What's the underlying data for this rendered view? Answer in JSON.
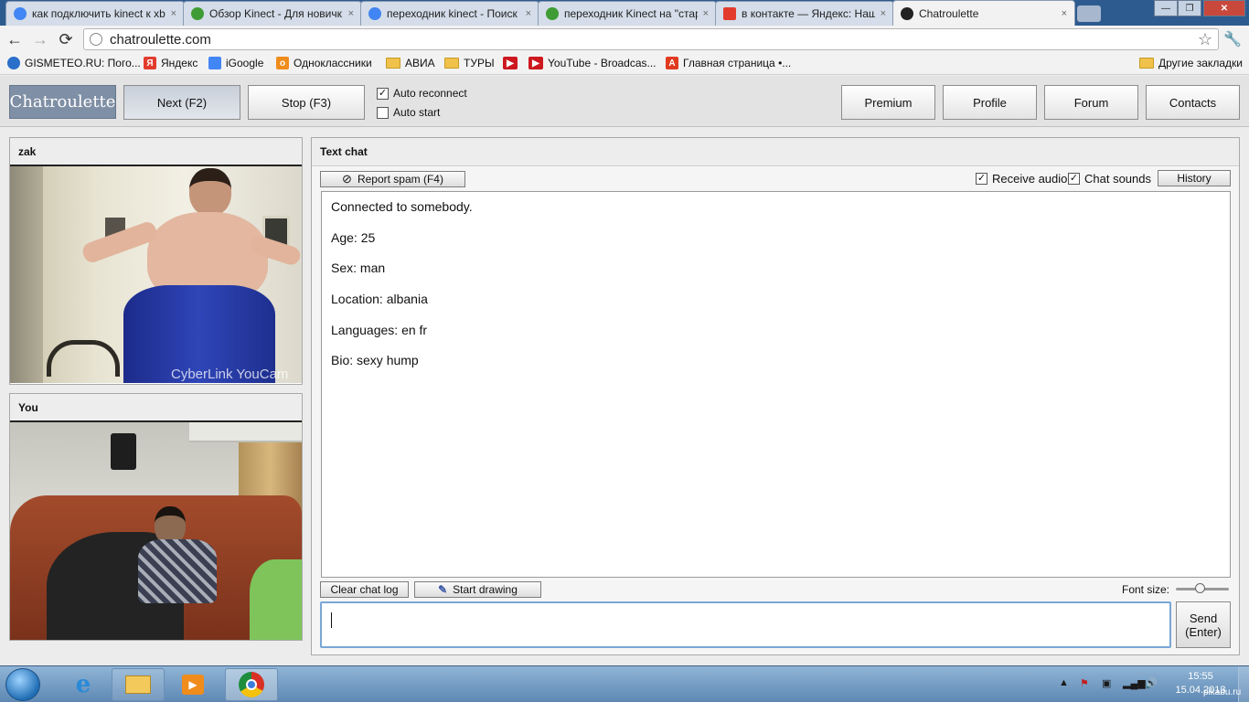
{
  "browser": {
    "tabs": [
      {
        "label": "как подключить kinect к xb",
        "color": "#4285f4"
      },
      {
        "label": "Обзор Kinect - Для новичк",
        "color": "#3f9c35"
      },
      {
        "label": "переходник kinect - Поиск",
        "color": "#4285f4"
      },
      {
        "label": "переходник Kinect на \"стар",
        "color": "#3f9c35"
      },
      {
        "label": "в контакте — Яндекс: Наш",
        "color": "#e23b2e"
      },
      {
        "label": "Chatroulette",
        "color": "#222222"
      }
    ],
    "tab_close": "×",
    "window_controls": {
      "minimize": "—",
      "maximize": "❐",
      "close": "✕"
    },
    "nav": {
      "back": "←",
      "forward": "→",
      "reload": "⟳"
    },
    "url": "chatroulette.com",
    "star_icon": "☆",
    "wrench_icon": "🔧",
    "bookmarks": [
      {
        "label": "GISMETEO.RU: Пого...",
        "icon": "gismeteo-icon",
        "color": "#2a6fc9"
      },
      {
        "label": "Яндекс",
        "icon": "yandex-icon",
        "color": "#e23b2e"
      },
      {
        "label": "iGoogle",
        "icon": "igoogle-icon",
        "color": "#4285f4"
      },
      {
        "label": "Одноклассники",
        "icon": "odnoklassniki-icon",
        "color": "#f08c1c"
      },
      {
        "label": "АВИА",
        "icon": "folder-icon",
        "color": "#f0c24c"
      },
      {
        "label": "ТУРЫ",
        "icon": "folder-icon",
        "color": "#f0c24c"
      },
      {
        "label": "",
        "icon": "youtube-icon",
        "color": "#cc181e"
      },
      {
        "label": "YouTube - Broadcas...",
        "icon": "youtube-icon",
        "color": "#cc181e"
      },
      {
        "label": "Главная страница •...",
        "icon": "adobe-icon",
        "color": "#e03a1f"
      }
    ],
    "other_bookmarks": "Другие закладки"
  },
  "app": {
    "logo": "Chatroulette",
    "next_label": "Next (F2)",
    "stop_label": "Stop (F3)",
    "auto_reconnect": {
      "label": "Auto reconnect",
      "checked": true
    },
    "auto_start": {
      "label": "Auto start",
      "checked": false
    },
    "nav": [
      "Premium",
      "Profile",
      "Forum",
      "Contacts"
    ]
  },
  "partner": {
    "name": "zak",
    "watermark": "CyberLink YouCam"
  },
  "self": {
    "name": "You"
  },
  "chat": {
    "title": "Text chat",
    "report_spam": "Report spam (F4)",
    "receive_audio": {
      "label": "Receive audio",
      "checked": true
    },
    "chat_sounds": {
      "label": "Chat sounds",
      "checked": true
    },
    "history": "History",
    "lines": [
      "Connected to somebody.",
      "Age: 25",
      "Sex: man",
      "Location: albania",
      "Languages: en fr",
      "Bio: sexy hump"
    ],
    "clear_log": "Clear chat log",
    "start_drawing": "Start drawing",
    "font_size_label": "Font size:",
    "font_size_level": 0.45,
    "send_line1": "Send",
    "send_line2": "(Enter)",
    "message_value": ""
  },
  "taskbar": {
    "time": "15:55",
    "date": "15.04.2013",
    "watermark": "pikabu.ru"
  }
}
